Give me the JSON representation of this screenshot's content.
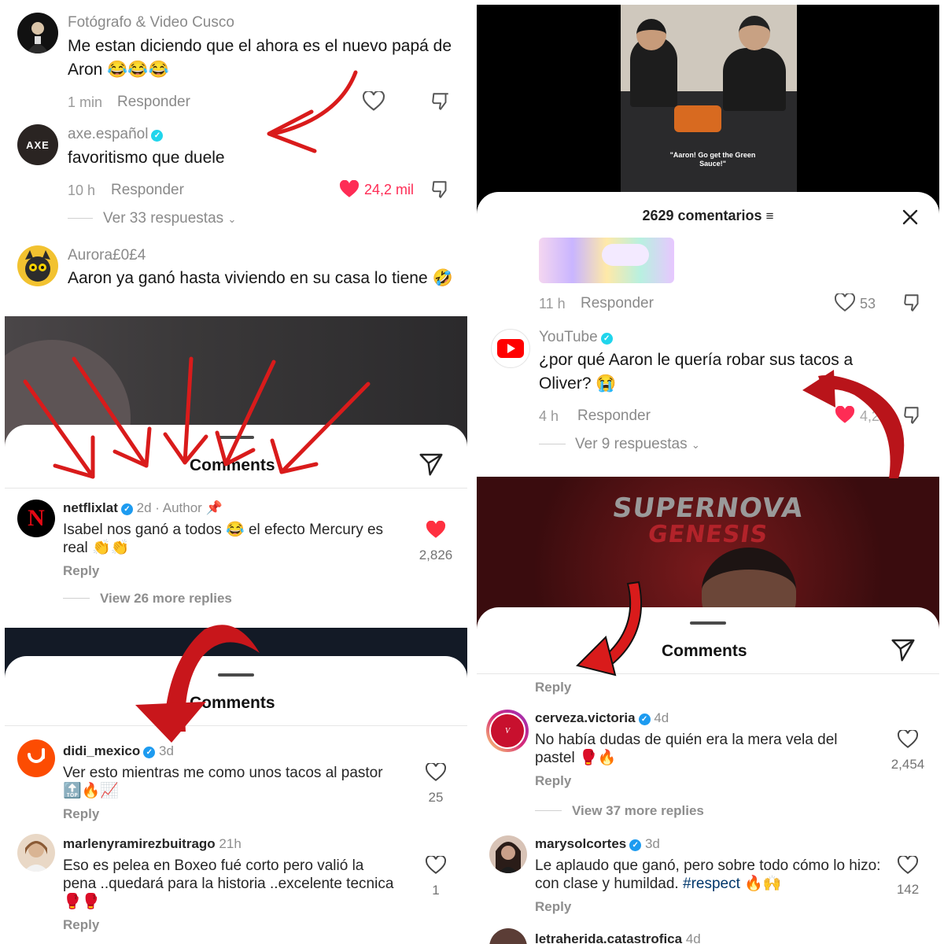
{
  "p1": {
    "c1": {
      "user": "Fotógrafo & Video Cusco",
      "text": "Me estan diciendo que el ahora es el nuevo papá de Aron 😂😂😂",
      "time": "1 min",
      "reply": "Responder"
    },
    "c2": {
      "user": "axe.español",
      "avatar_text": "AXE",
      "text": "favoritismo que duele",
      "time": "10 h",
      "reply": "Responder",
      "likes": "24,2 mil",
      "view_replies": "Ver 33 respuestas"
    },
    "c3": {
      "user": "Aurora£0£4",
      "text": "Aaron ya ganó hasta viviendo en su casa lo tiene 🤣"
    }
  },
  "p2": {
    "video_caption": "\"Aaron! Go get the Green Sauce!\"",
    "header_count": "2629 comentarios",
    "c1": {
      "time": "11 h",
      "reply": "Responder",
      "likes": "53"
    },
    "c2": {
      "user": "YouTube",
      "text": "¿por qué Aaron le quería robar sus tacos a Oliver? 😭",
      "time": "4 h",
      "reply": "Responder",
      "likes": "4,2",
      "view_replies": "Ver 9 respuestas"
    }
  },
  "p3": {
    "title": "Comments",
    "c1": {
      "user": "netflixlat",
      "time": "2d",
      "author": "Author",
      "text": "Isabel nos ganó a todos 😂 el efecto Mercury es real 👏👏",
      "reply": "Reply",
      "likes": "2,826",
      "view_replies": "View 26 more replies"
    }
  },
  "p4": {
    "title": "Comments",
    "c1": {
      "user": "didi_mexico",
      "time": "3d",
      "text": "Ver esto mientras me como unos tacos al pastor 🔝🔥📈",
      "reply": "Reply",
      "likes": "25"
    },
    "c2": {
      "user": "marlenyramirezbuitrago",
      "time": "21h",
      "text": "Eso es pelea en Boxeo fué corto pero valió la pena ..quedará para la historia ..excelente tecnica 🥊🥊",
      "reply": "Reply",
      "likes": "1"
    }
  },
  "p5": {
    "banner_line1": "SUPERNOVA",
    "banner_line2": "GENESIS",
    "title": "Comments",
    "top_reply": "Reply",
    "c1": {
      "user": "cerveza.victoria",
      "time": "4d",
      "text": "No había dudas de quién era la mera vela del pastel 🥊🔥",
      "reply": "Reply",
      "likes": "2,454",
      "view_replies": "View 37 more replies"
    },
    "c2": {
      "user": "marysolcortes",
      "time": "3d",
      "text_a": "Le aplaudo que ganó, pero sobre todo cómo lo hizo: con clase y humildad. ",
      "hashtag": "#respect",
      "text_b": " 🔥🙌",
      "reply": "Reply",
      "likes": "142"
    },
    "c3": {
      "user": "letraherida.catastrofica",
      "time": "4d"
    }
  },
  "colors": {
    "red_arrow": "#d91b1b",
    "like_red": "#fe2c55",
    "ig_red": "#ff3040",
    "verified": "#1d9bf0",
    "hashtag": "#00376b"
  }
}
